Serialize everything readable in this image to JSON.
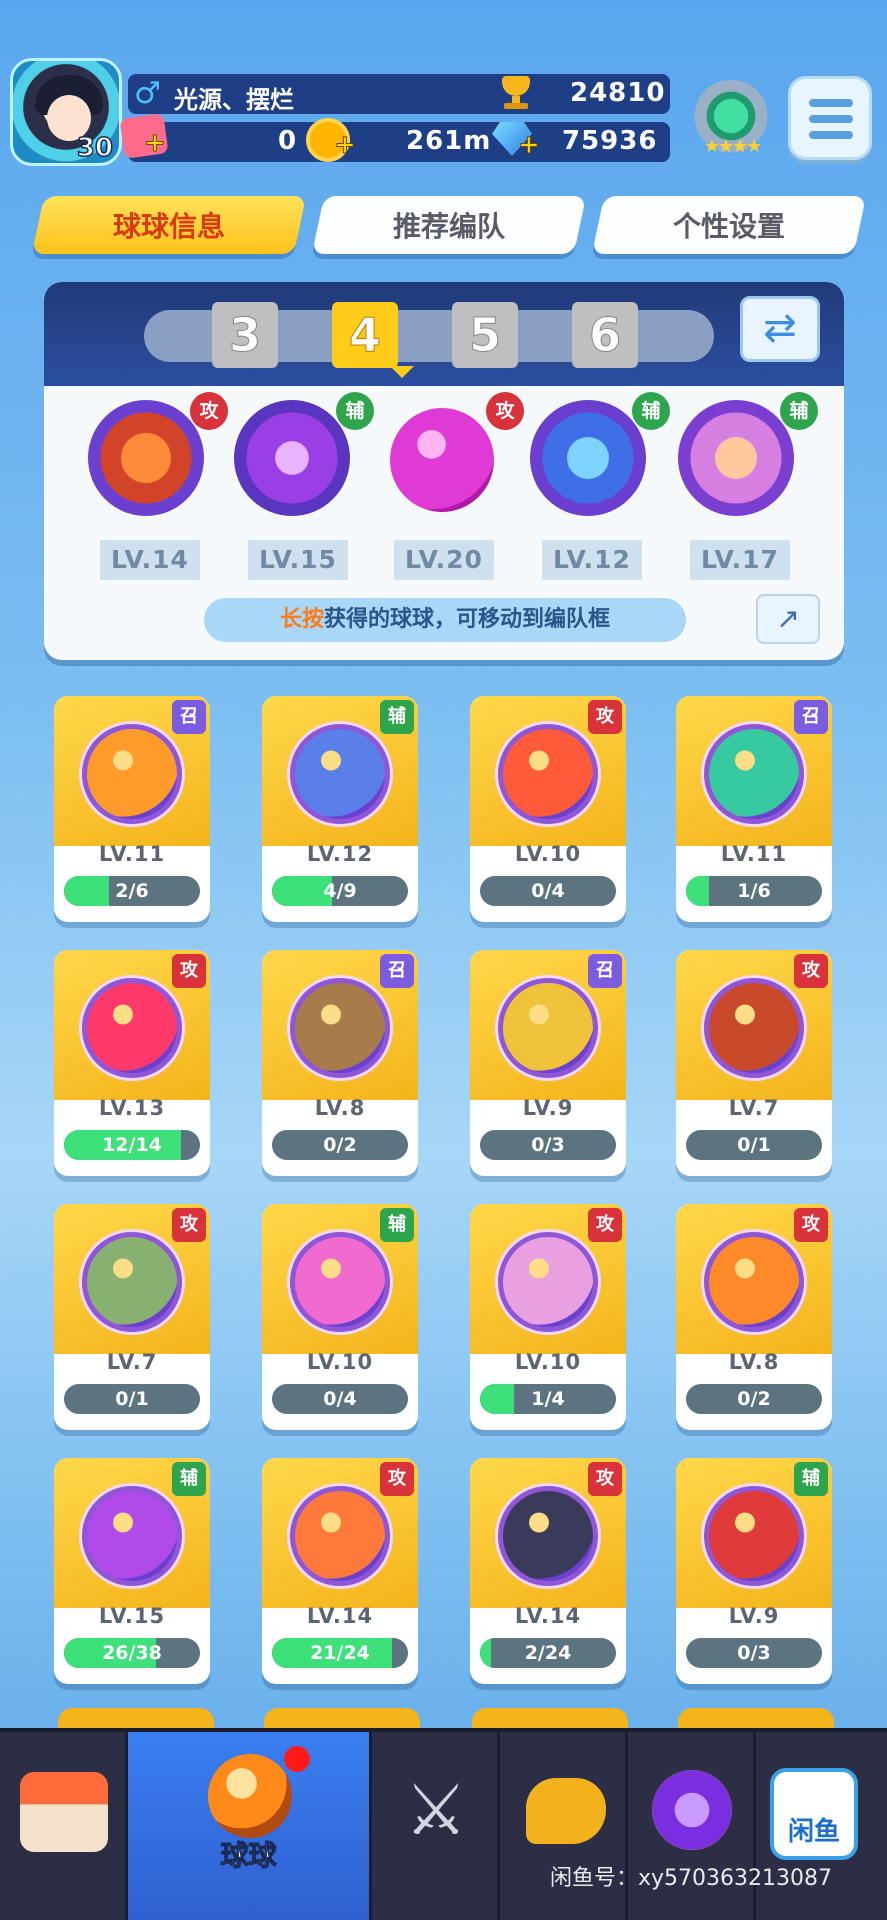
{
  "player": {
    "name": "光源、摆烂",
    "level": "30",
    "trophies": "24810",
    "tickets": "0",
    "coins": "261m",
    "diamonds": "75936"
  },
  "tabs": [
    "球球信息",
    "推荐编队",
    "个性设置"
  ],
  "team": {
    "slots": [
      "3",
      "4",
      "5",
      "6"
    ],
    "selected_slot": "4",
    "balls": [
      {
        "tag": "攻",
        "level": "LV.14"
      },
      {
        "tag": "辅",
        "level": "LV.15"
      },
      {
        "tag": "攻",
        "level": "LV.20"
      },
      {
        "tag": "辅",
        "level": "LV.12"
      },
      {
        "tag": "辅",
        "level": "LV.17"
      }
    ],
    "hint_highlight": "长按",
    "hint_rest": "获得的球球，可移动到编队框"
  },
  "balls": [
    {
      "tag": "召",
      "level": "LV.11",
      "progress": "2/6",
      "fill": 0.33
    },
    {
      "tag": "辅",
      "level": "LV.12",
      "progress": "4/9",
      "fill": 0.44
    },
    {
      "tag": "攻",
      "level": "LV.10",
      "progress": "0/4",
      "fill": 0
    },
    {
      "tag": "召",
      "level": "LV.11",
      "progress": "1/6",
      "fill": 0.17
    },
    {
      "tag": "攻",
      "level": "LV.13",
      "progress": "12/14",
      "fill": 0.86
    },
    {
      "tag": "召",
      "level": "LV.8",
      "progress": "0/2",
      "fill": 0
    },
    {
      "tag": "召",
      "level": "LV.9",
      "progress": "0/3",
      "fill": 0
    },
    {
      "tag": "攻",
      "level": "LV.7",
      "progress": "0/1",
      "fill": 0
    },
    {
      "tag": "攻",
      "level": "LV.7",
      "progress": "0/1",
      "fill": 0
    },
    {
      "tag": "辅",
      "level": "LV.10",
      "progress": "0/4",
      "fill": 0
    },
    {
      "tag": "攻",
      "level": "LV.10",
      "progress": "1/4",
      "fill": 0.25
    },
    {
      "tag": "攻",
      "level": "LV.8",
      "progress": "0/2",
      "fill": 0
    },
    {
      "tag": "辅",
      "level": "LV.15",
      "progress": "26/38",
      "fill": 0.68
    },
    {
      "tag": "攻",
      "level": "LV.14",
      "progress": "21/24",
      "fill": 0.88
    },
    {
      "tag": "攻",
      "level": "LV.14",
      "progress": "2/24",
      "fill": 0.08
    },
    {
      "tag": "辅",
      "level": "LV.9",
      "progress": "0/3",
      "fill": 0
    }
  ],
  "nav": {
    "active_label": "球球",
    "items": [
      "shop-icon",
      "ball-icon",
      "swords-icon",
      "whistle-icon",
      "planet-icon",
      "xianyu-icon"
    ],
    "xianyu_label": "闲鱼"
  },
  "watermark": "闲鱼号：xy570363213087"
}
